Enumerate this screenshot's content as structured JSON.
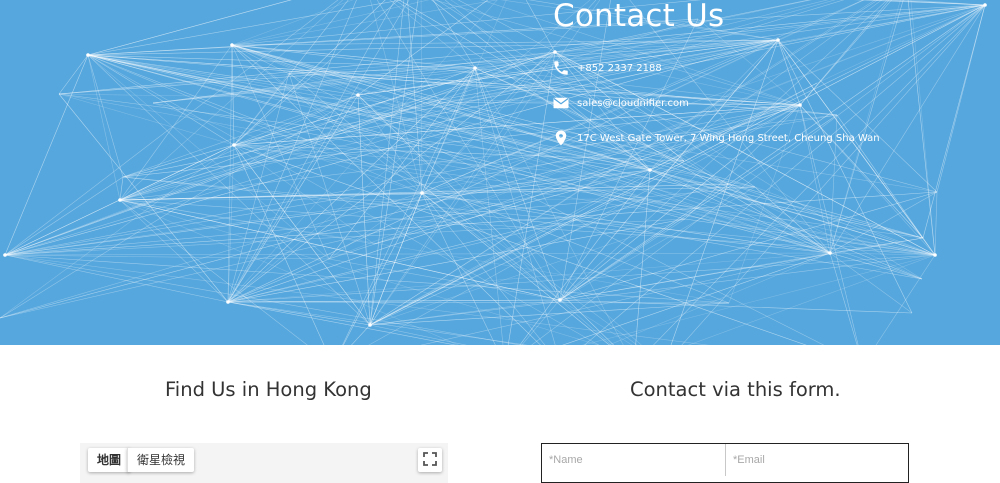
{
  "hero": {
    "title": "Contact Us",
    "phone": "+852 2337 2188",
    "email": "sales@cloudnifier.com",
    "address": "17C West Gate Tower, 7 Wing Hong Street, Cheung Sha Wan",
    "background_color": "#56a7de"
  },
  "find_us": {
    "title": "Find Us in Hong Kong",
    "map": {
      "map_tab": "地圖",
      "satellite_tab": "衛星檢視",
      "fullscreen_icon": "fullscreen-icon"
    }
  },
  "contact_form": {
    "title": "Contact via this form.",
    "name_placeholder": "*Name",
    "email_placeholder": "*Email"
  }
}
